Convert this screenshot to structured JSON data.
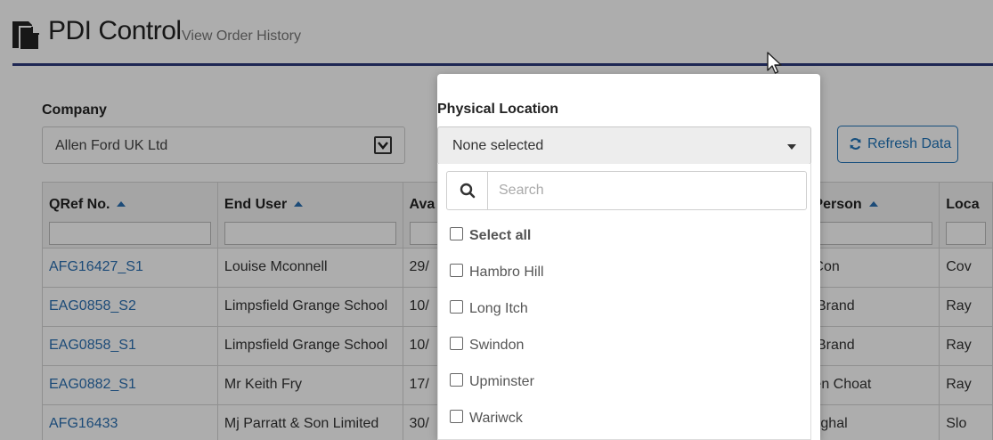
{
  "header": {
    "title": "PDI Control",
    "sub_link": "View Order History"
  },
  "filters": {
    "company_label": "Company",
    "company_value": "Allen Ford UK Ltd",
    "physical_location_label": "Physical Location",
    "physical_location_value": "None selected",
    "refresh_label": "Refresh Data"
  },
  "dropdown": {
    "search_placeholder": "Search",
    "options": [
      "Select all",
      "Hambro Hill",
      "Long Itch",
      "Swindon",
      "Upminster",
      "Wariwck"
    ]
  },
  "table": {
    "columns": [
      "QRef No.",
      "End User",
      "Ava",
      "",
      "les Person",
      "Loca"
    ],
    "rows": [
      [
        "AFG16427_S1",
        "Louise Mconnell",
        "29/",
        "",
        "em Con",
        "Cov"
      ],
      [
        "EAG0858_S2",
        "Limpsfield Grange School",
        "10/",
        "",
        "nce Brand",
        "Ray"
      ],
      [
        "EAG0858_S1",
        "Limpsfield Grange School",
        "10/",
        "",
        "nce Brand",
        "Ray"
      ],
      [
        "EAG0882_S1",
        "Mr Keith Fry",
        "17/",
        "",
        "ephen Choat",
        "Ray"
      ],
      [
        "AFG16433",
        "Mj Parratt & Son Limited",
        "30/",
        "",
        "if Mughal",
        "Slo"
      ]
    ]
  },
  "colors": {
    "accent": "#2d3a7c",
    "link": "#2a6fb1",
    "button": "#1f74b8"
  }
}
